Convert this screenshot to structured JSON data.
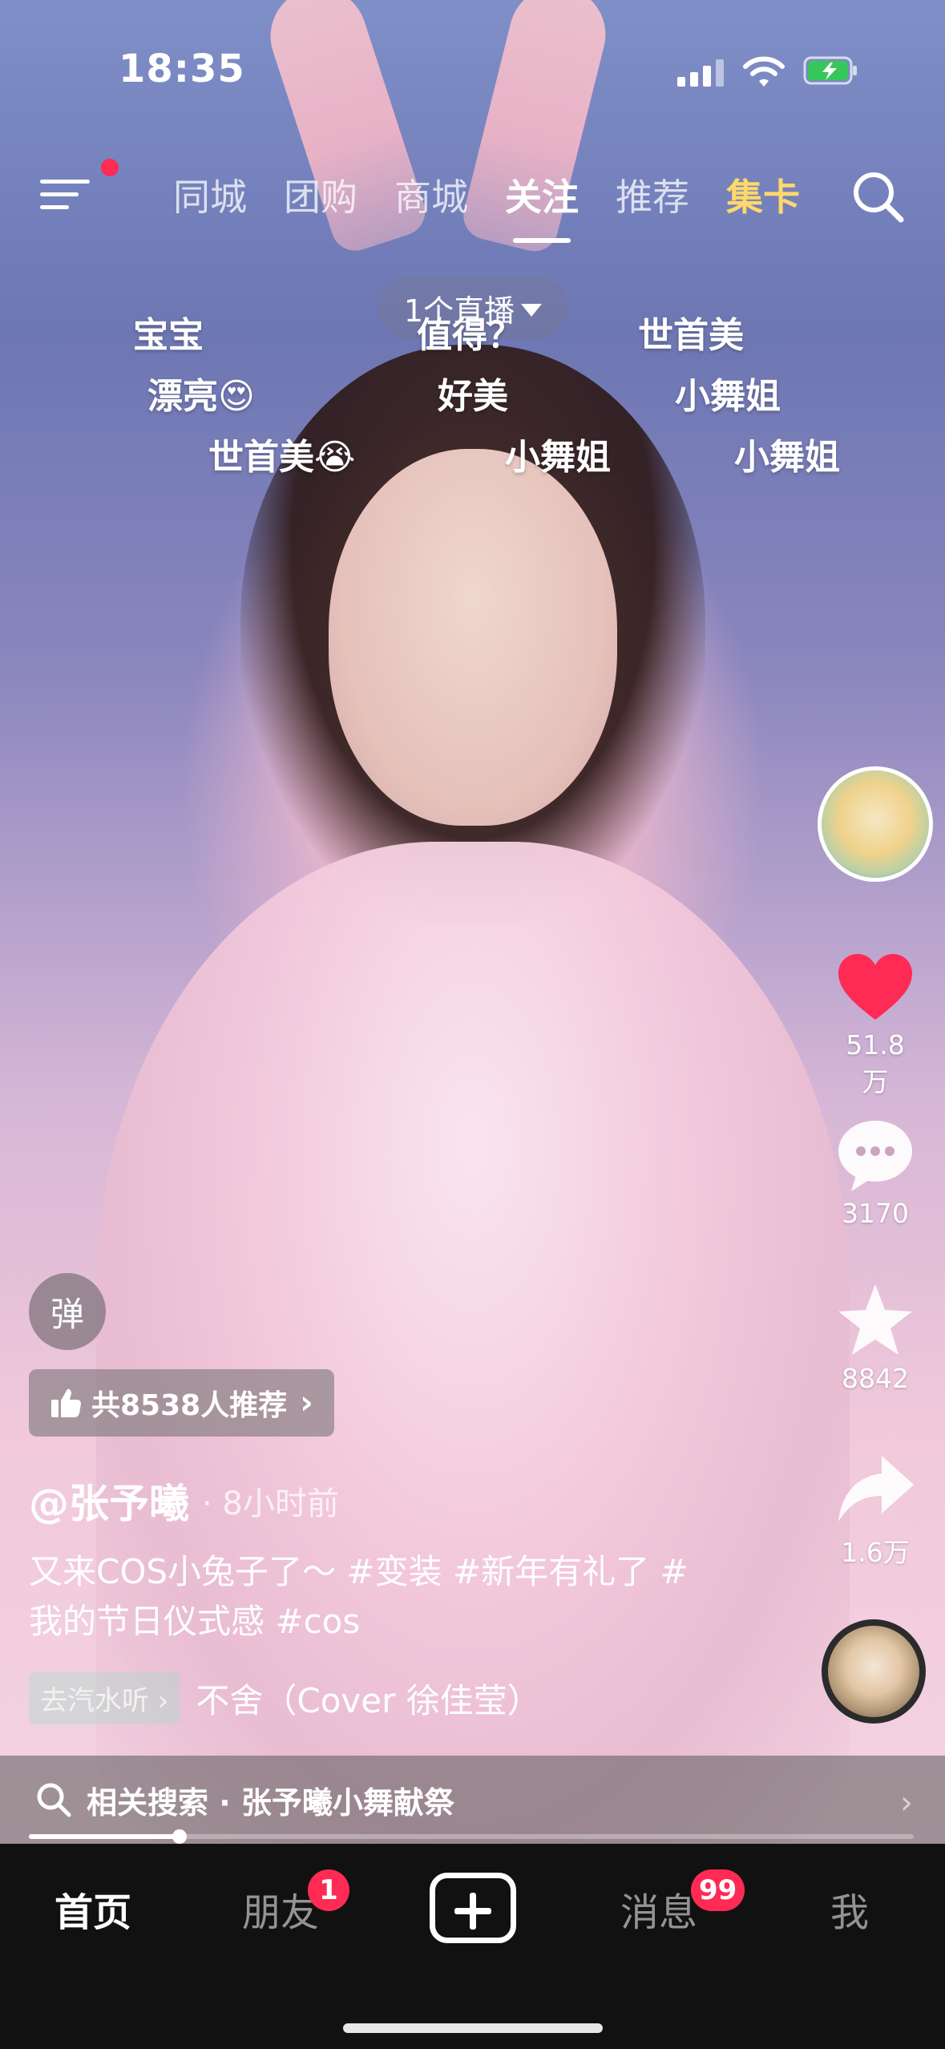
{
  "status_bar": {
    "time": "18:35"
  },
  "top_nav": {
    "tabs": [
      {
        "label": "同城"
      },
      {
        "label": "团购"
      },
      {
        "label": "商城"
      },
      {
        "label": "关注"
      },
      {
        "label": "推荐"
      },
      {
        "label": "集卡"
      }
    ],
    "active_tab": "关注"
  },
  "live_pill": {
    "label": "1个直播"
  },
  "danmu": [
    {
      "text": "宝宝"
    },
    {
      "text": "值得？"
    },
    {
      "text": "世首美"
    },
    {
      "text": "漂亮😍"
    },
    {
      "text": "好美"
    },
    {
      "text": "小舞姐"
    },
    {
      "text": "世首美😭"
    },
    {
      "text": "小舞姐"
    },
    {
      "text": "小舞姐"
    }
  ],
  "actions": {
    "like_count": "51.8万",
    "comment_count": "3170",
    "favorite_count": "8842",
    "share_count": "1.6万"
  },
  "overlay": {
    "danmu_button": "弹",
    "recommend_text": "共8538人推荐",
    "author": "@张予曦",
    "time_ago": "· 8小时前",
    "description": "又来COS小兔子了～ #变装 #新年有礼了 #我的节日仪式感 #cos",
    "music_tag": "去汽水听 ›",
    "music_title": "不舍（Cover 徐佳莹）"
  },
  "related_search": {
    "label": "相关搜索 · 张予曦小舞献祭"
  },
  "progress": {
    "fraction": 0.17
  },
  "bottom_nav": {
    "items": [
      {
        "label": "首页"
      },
      {
        "label": "朋友"
      },
      {
        "label": "消息"
      },
      {
        "label": "我"
      }
    ],
    "friends_badge": "1",
    "messages_badge": "99"
  },
  "colors": {
    "accent": "#ff2b54",
    "highlight_tab": "#ffd86a",
    "like": "#ff2b54"
  }
}
